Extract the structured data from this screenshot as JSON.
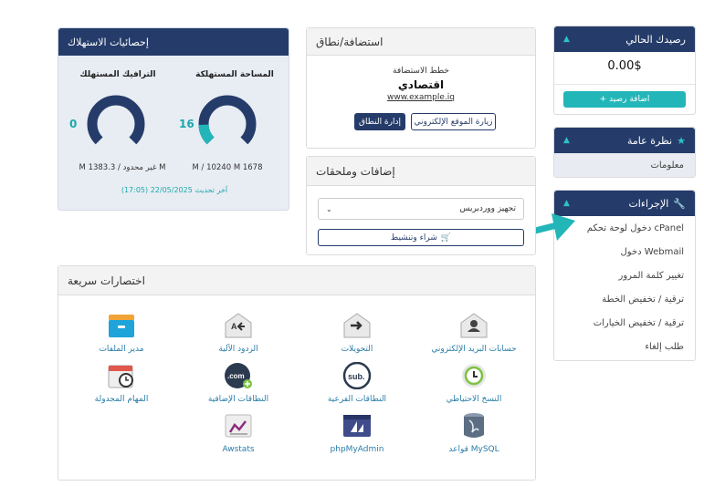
{
  "balance": {
    "title": "رصيدك الحالي",
    "amount": "0.00$",
    "add_label": "+ اضافة رصيد"
  },
  "overview": {
    "title": "نظرة عامة",
    "item": "معلومات"
  },
  "actions": {
    "title": "الإجراءات",
    "items": [
      "دخول لوحة تحكم cPanel",
      "دخول Webmail",
      "تغيير كلمة المرور",
      "ترقية / تخفيض الخطة",
      "ترقية / تخفيض الخيارات",
      "طلب إلغاء"
    ]
  },
  "hosting": {
    "title": "استضافة/نطاق",
    "plan_label": "خطط الاستضافة",
    "plan_name": "اقتصادي",
    "domain": "www.example.iq",
    "visit_label": "زيارة الموقع الإلكتروني",
    "manage_label": "إدارة النطاق"
  },
  "addons": {
    "title": "إضافات وملحقات",
    "select_value": "تجهيز ووردبريس",
    "buy_label": "شراء وتنشيط"
  },
  "usage": {
    "title": "إحصائيات الاستهلاك",
    "disk_label": "المساحة المستهلكة",
    "disk_value": "16",
    "disk_percent": 16,
    "disk_foot": "M / 10240 M 1678",
    "bw_label": "الترافيك المستهلك",
    "bw_value": "0",
    "bw_percent": 0,
    "bw_foot": "M 1383.3 / غير محدود M",
    "updated": "آخر تحديث 22/05/2025 (17:05)"
  },
  "shortcuts": {
    "title": "اختصارات سريعة",
    "items": [
      {
        "label": "حسابات البريد الإلكتروني",
        "icon": "email-account-icon"
      },
      {
        "label": "التحويلات",
        "icon": "forwarders-icon"
      },
      {
        "label": "الردود الآلية",
        "icon": "autoresponders-icon"
      },
      {
        "label": "مدير الملفات",
        "icon": "file-manager-icon"
      },
      {
        "label": "النسخ الاحتياطي",
        "icon": "backup-icon"
      },
      {
        "label": "النطاقات الفرعية",
        "icon": "subdomains-icon"
      },
      {
        "label": "النطاقات الإضافية",
        "icon": "addon-domains-icon"
      },
      {
        "label": "المهام المجدولة",
        "icon": "cron-jobs-icon"
      },
      {
        "label": "قواعد MySQL",
        "icon": "mysql-icon"
      },
      {
        "label": "phpMyAdmin",
        "icon": "phpmyadmin-icon"
      },
      {
        "label": "Awstats",
        "icon": "awstats-icon"
      }
    ]
  },
  "colors": {
    "navy": "#253c6a",
    "teal": "#23b6b9"
  }
}
